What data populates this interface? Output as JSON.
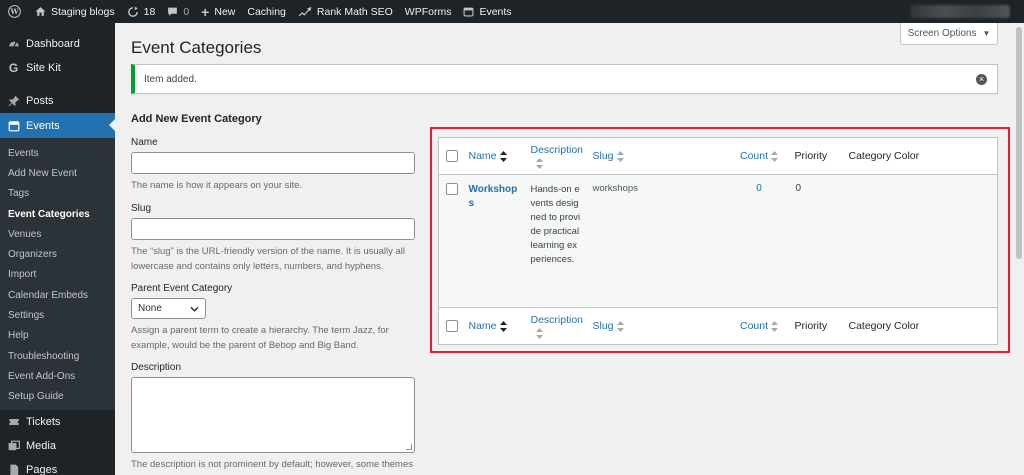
{
  "admin_bar": {
    "site_name": "Staging blogs",
    "updates_count": "18",
    "comments_count": "0",
    "new_label": "New",
    "caching_label": "Caching",
    "rank_math_label": "Rank Math SEO",
    "wpforms_label": "WPForms",
    "events_label": "Events"
  },
  "sidebar": {
    "dashboard": "Dashboard",
    "site_kit": "Site Kit",
    "posts": "Posts",
    "events": "Events",
    "submenu": [
      "Events",
      "Add New Event",
      "Tags",
      "Event Categories",
      "Venues",
      "Organizers",
      "Import",
      "Calendar Embeds",
      "Settings",
      "Help",
      "Troubleshooting",
      "Event Add-Ons",
      "Setup Guide"
    ],
    "tickets": "Tickets",
    "media": "Media",
    "pages": "Pages"
  },
  "page": {
    "title": "Event Categories",
    "screen_options": "Screen Options",
    "notice": "Item added."
  },
  "form": {
    "heading": "Add New Event Category",
    "name_label": "Name",
    "name_help": "The name is how it appears on your site.",
    "slug_label": "Slug",
    "slug_help": "The “slug” is the URL-friendly version of the name. It is usually all lowercase and contains only letters, numbers, and hyphens.",
    "parent_label": "Parent Event Category",
    "parent_value": "None",
    "parent_help": "Assign a parent term to create a hierarchy. The term Jazz, for example, would be the parent of Bebop and Big Band.",
    "description_label": "Description",
    "description_help": "The description is not prominent by default; however, some themes may show it."
  },
  "table": {
    "columns": {
      "name": "Name",
      "description": "Description",
      "slug": "Slug",
      "count": "Count",
      "priority": "Priority",
      "category_color": "Category Color"
    },
    "rows": [
      {
        "name": "Workshops",
        "description": "Hands-on events designed to provide practical learning experiences.",
        "slug": "workshops",
        "count": "0",
        "priority": "0",
        "category_color": ""
      }
    ]
  },
  "colors": {
    "admin_bar": "#1d2327",
    "accent": "#2271b1",
    "notice_success": "#00a32a",
    "highlight_box": "#e0232a"
  }
}
